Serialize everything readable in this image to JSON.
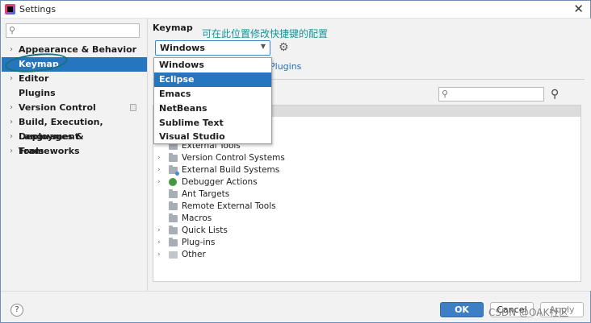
{
  "window": {
    "title": "Settings",
    "close_glyph": "✕"
  },
  "sidebar": {
    "search_icon": "search-icon",
    "items": [
      {
        "label": "Appearance & Behavior",
        "expandable": true,
        "selected": false
      },
      {
        "label": "Keymap",
        "expandable": false,
        "selected": true
      },
      {
        "label": "Editor",
        "expandable": true,
        "selected": false
      },
      {
        "label": "Plugins",
        "expandable": false,
        "selected": false
      },
      {
        "label": "Version Control",
        "expandable": true,
        "selected": false
      },
      {
        "label": "Build, Execution, Deployment",
        "expandable": true,
        "selected": false
      },
      {
        "label": "Languages & Frameworks",
        "expandable": true,
        "selected": false
      },
      {
        "label": "Tools",
        "expandable": true,
        "selected": false
      }
    ]
  },
  "main": {
    "heading": "Keymap",
    "annotation": "可在此位置修改快捷键的配置",
    "keymap_select": {
      "value": "Windows",
      "options": [
        "Windows",
        "Eclipse",
        "Emacs",
        "NetBeans",
        "Sublime Text",
        "Visual Studio"
      ],
      "highlighted": "Eclipse"
    },
    "tabs": {
      "plugins_fragment": "Plugins"
    },
    "tree": [
      {
        "label": "External Tools",
        "expandable": false,
        "icon": "folder-icon"
      },
      {
        "label": "Version Control Systems",
        "expandable": true,
        "icon": "folder-icon"
      },
      {
        "label": "External Build Systems",
        "expandable": true,
        "icon": "build-folder-icon"
      },
      {
        "label": "Debugger Actions",
        "expandable": true,
        "icon": "bug-icon"
      },
      {
        "label": "Ant Targets",
        "expandable": false,
        "icon": "folder-icon"
      },
      {
        "label": "Remote External Tools",
        "expandable": false,
        "icon": "folder-icon"
      },
      {
        "label": "Macros",
        "expandable": false,
        "icon": "folder-icon"
      },
      {
        "label": "Quick Lists",
        "expandable": true,
        "icon": "folder-icon"
      },
      {
        "label": "Plug-ins",
        "expandable": true,
        "icon": "folder-icon"
      },
      {
        "label": "Other",
        "expandable": true,
        "icon": "other-icon"
      }
    ]
  },
  "footer": {
    "help": "?",
    "ok": "OK",
    "cancel": "Cancel",
    "apply": "Apply",
    "watermark": "CSDN @OAK社区"
  },
  "colors": {
    "selection": "#2675bf",
    "annotation": "#15949a",
    "ok_button": "#3c7fc4"
  }
}
